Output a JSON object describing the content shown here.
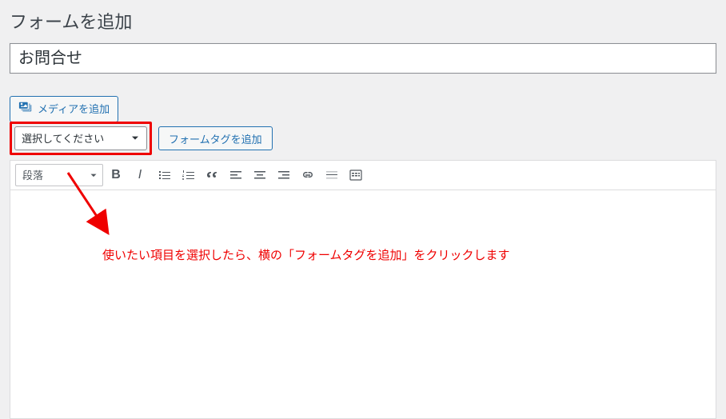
{
  "page": {
    "title": "フォームを追加"
  },
  "form": {
    "title_value": "お問合せ"
  },
  "buttons": {
    "add_media": "メディアを追加",
    "add_form_tag": "フォームタグを追加"
  },
  "selects": {
    "field_placeholder": "選択してください",
    "format_value": "段落"
  },
  "toolbar": {
    "bold": "B",
    "italic": "I"
  },
  "annotation": {
    "text": "使いたい項目を選択したら、横の「フォームタグを追加」をクリックします"
  }
}
